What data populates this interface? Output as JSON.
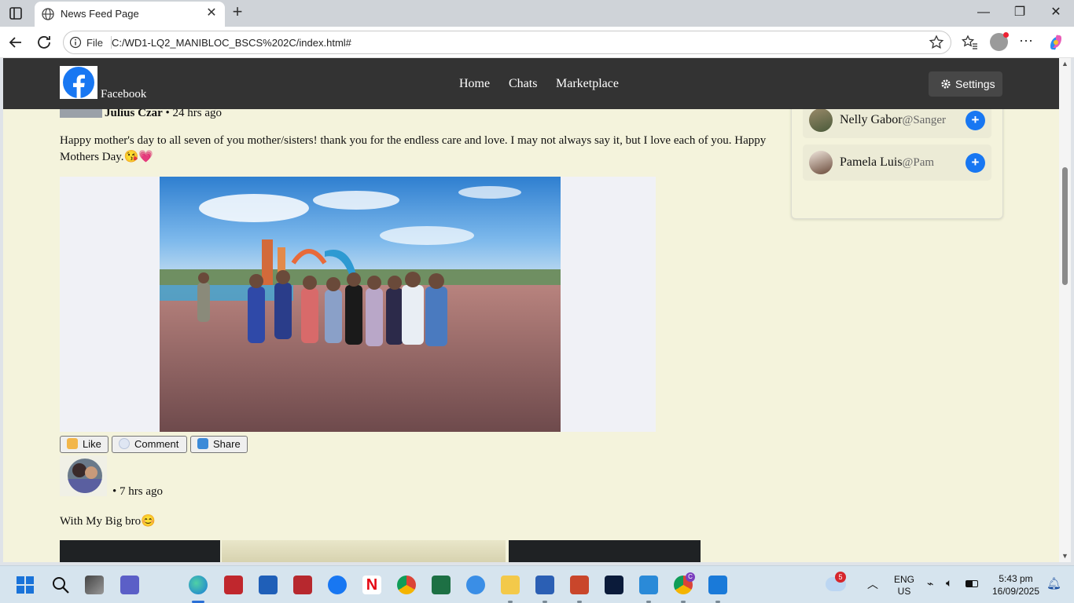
{
  "browser": {
    "tab_title": "News Feed Page",
    "scheme_label": "File",
    "url": "C:/WD1-LQ2_MANIBLOC_BSCS%202C/index.html#"
  },
  "header": {
    "brand": "Facebook",
    "nav": [
      "Home",
      "Chats",
      "Marketplace"
    ],
    "settings_label": "Settings"
  },
  "post1": {
    "author": "Julius Czar",
    "time": " • 24 hrs ago",
    "text": "Happy mother's day to all seven of you mother/sisters! thank you for the endless care and love. I may not always say it, but I love each of you. Happy Mothers Day.😘💗"
  },
  "actions": {
    "like": "Like",
    "comment": "Comment",
    "share": "Share"
  },
  "post2": {
    "time": "• 7 hrs ago",
    "text": "With My Big bro😊"
  },
  "suggestions": [
    {
      "name": "Nelly Gabor",
      "handle": "@Sanger"
    },
    {
      "name": "Pamela Luis",
      "handle": "@Pam"
    }
  ],
  "taskbar": {
    "lang1": "ENG",
    "lang2": "US",
    "time": "5:43 pm",
    "date": "16/09/2025",
    "weather_badge": "5",
    "chrome_badge": "C"
  },
  "colors": {
    "page_bg": "#f4f3dc",
    "header_bg": "#333333",
    "accent": "#1877f2"
  }
}
